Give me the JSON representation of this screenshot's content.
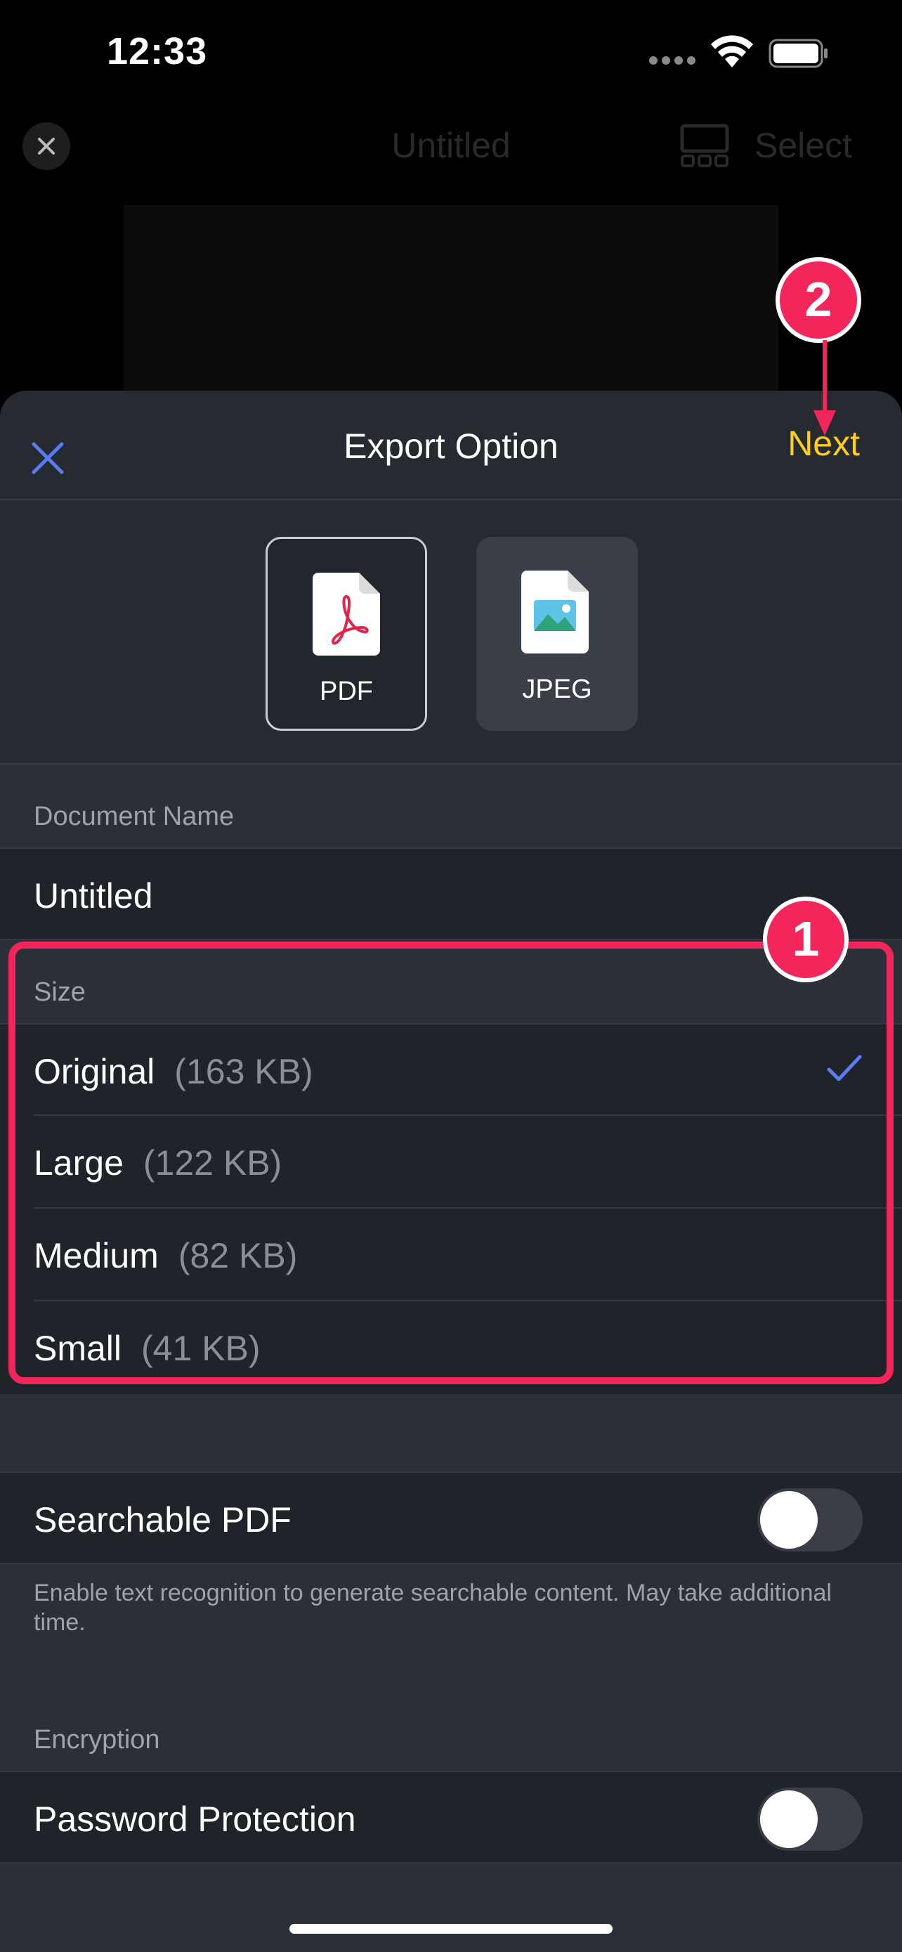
{
  "status_bar": {
    "time": "12:33"
  },
  "background_screen": {
    "title": "Untitled",
    "select_label": "Select"
  },
  "sheet": {
    "title": "Export Option",
    "next_label": "Next",
    "formats": [
      {
        "label": "PDF",
        "selected": true,
        "icon": "pdf-file-icon"
      },
      {
        "label": "JPEG",
        "selected": false,
        "icon": "image-file-icon"
      }
    ],
    "document_name": {
      "header": "Document Name",
      "value": "Untitled"
    },
    "size": {
      "header": "Size",
      "options": [
        {
          "label": "Original",
          "size": "(163 KB)",
          "selected": true
        },
        {
          "label": "Large",
          "size": "(122 KB)",
          "selected": false
        },
        {
          "label": "Medium",
          "size": "(82 KB)",
          "selected": false
        },
        {
          "label": "Small",
          "size": "(41 KB)",
          "selected": false
        }
      ]
    },
    "searchable_pdf": {
      "label": "Searchable PDF",
      "enabled": false,
      "note": "Enable text recognition to generate searchable content. May take additional time."
    },
    "encryption": {
      "header": "Encryption",
      "password_label": "Password Protection",
      "enabled": false
    }
  },
  "annotations": {
    "badge_1": "1",
    "badge_2": "2"
  },
  "colors": {
    "accent_next": "#ffcc1f",
    "accent_blue": "#5b7cf5",
    "annotation_pink": "#f2265b",
    "sheet_bg": "#2b2f37",
    "row_bg": "#1f232a"
  }
}
